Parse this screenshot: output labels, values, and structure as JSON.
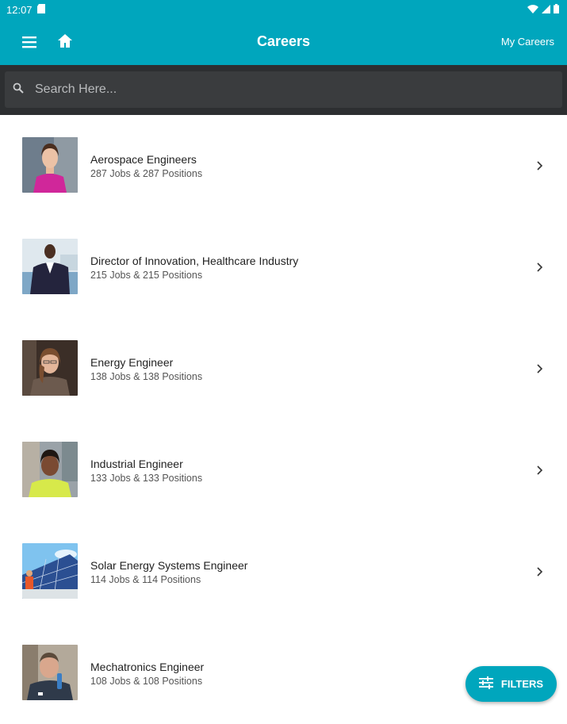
{
  "status_bar": {
    "time": "12:07"
  },
  "app_bar": {
    "title": "Careers",
    "my_careers_label": "My Careers"
  },
  "search": {
    "placeholder": "Search Here..."
  },
  "careers": [
    {
      "title": "Aerospace Engineers",
      "subtitle": "287 Jobs & 287 Positions",
      "photo": "woman-magenta-top"
    },
    {
      "title": "Director of Innovation, Healthcare Industry",
      "subtitle": "215 Jobs & 215 Positions",
      "photo": "man-suit-office"
    },
    {
      "title": "Energy Engineer",
      "subtitle": "138 Jobs & 138 Positions",
      "photo": "woman-glasses"
    },
    {
      "title": "Industrial Engineer",
      "subtitle": "133 Jobs & 133 Positions",
      "photo": "woman-yellow-shirt"
    },
    {
      "title": "Solar Energy Systems Engineer",
      "subtitle": "114 Jobs & 114 Positions",
      "photo": "solar-panels"
    },
    {
      "title": "Mechatronics Engineer",
      "subtitle": "108 Jobs & 108 Positions",
      "photo": "man-microphone"
    }
  ],
  "fab": {
    "label": "FILTERS"
  },
  "colors": {
    "primary": "#00a6bd",
    "search_bg": "#2d2f31"
  }
}
